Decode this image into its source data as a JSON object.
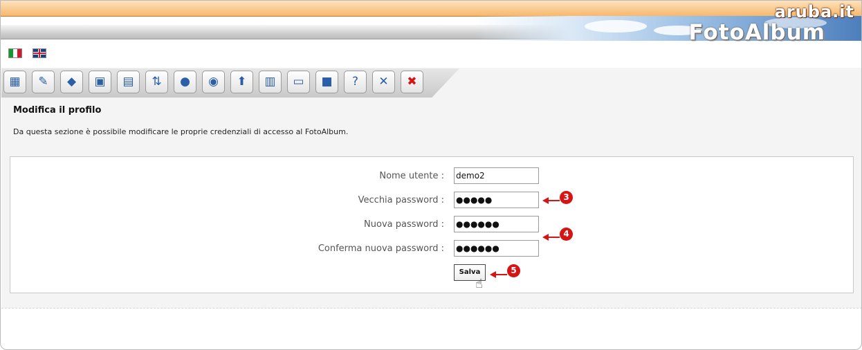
{
  "header": {
    "brand": "aruba.it",
    "logo": "FotoAlbum"
  },
  "languages": [
    {
      "name": "italian-flag-icon"
    },
    {
      "name": "english-flag-icon"
    }
  ],
  "toolbar": {
    "icons": [
      "album-icon",
      "text-edit-icon",
      "book-icon",
      "add-image-icon",
      "edit-image-icon",
      "sort-icon",
      "add-video-icon",
      "edit-video-icon",
      "publish-icon",
      "site-edit-icon",
      "monitor-icon",
      "box-icon",
      "help-icon",
      "tools-icon",
      "logout-icon"
    ]
  },
  "page": {
    "title": "Modifica il profilo",
    "description": "Da questa sezione è possibile modificare le proprie credenziali di accesso al FotoAlbum."
  },
  "form": {
    "username_label": "Nome utente :",
    "username_value": "demo2",
    "old_password_label": "Vecchia password :",
    "old_password_value": "●●●●●",
    "new_password_label": "Nuova password :",
    "new_password_value": "●●●●●●",
    "confirm_password_label": "Conferma nuova password :",
    "confirm_password_value": "●●●●●●",
    "save_label": "Salva"
  },
  "annotations": {
    "step3": "3",
    "step4": "4",
    "step5": "5"
  },
  "colors": {
    "annotation": "#d71414",
    "header_orange": "#f7b86d"
  }
}
